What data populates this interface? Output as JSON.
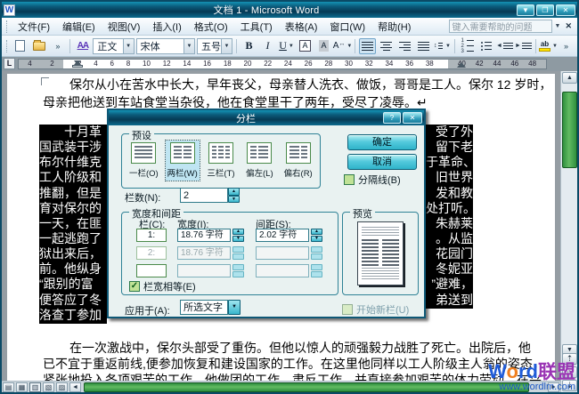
{
  "window": {
    "title": "文档 1 - Microsoft Word",
    "min_glyph": "▼",
    "restore_glyph": "❐",
    "close_glyph": "✕",
    "app_initial": "W"
  },
  "menu": {
    "items": [
      "文件(F)",
      "编辑(E)",
      "视图(V)",
      "插入(I)",
      "格式(O)",
      "工具(T)",
      "表格(A)",
      "窗口(W)",
      "帮助(H)"
    ],
    "help_placeholder": "键入需要帮助的问题",
    "dropdown_glyph": "▼",
    "close_glyph": "✕"
  },
  "toolbar": {
    "overflow_glyph": "»",
    "styles_icon": "AA",
    "style_value": "正文",
    "font_value": "宋体",
    "size_value": "五号",
    "bold": "B",
    "italic": "I",
    "underline": "U",
    "char_border": "A",
    "char_shading": "A",
    "char_scale": "A",
    "highlight_ab": "ab",
    "caret_glyph": "▼",
    "updown_glyph": "↕",
    "num1": "1",
    "num2": "2",
    "num3": "3",
    "left_tri": "◄",
    "right_tri": "►"
  },
  "ruler": {
    "left": [
      "4",
      "2"
    ],
    "mid": [
      "2",
      "4",
      "6",
      "8",
      "10",
      "12",
      "14",
      "16",
      "18",
      "20",
      "22",
      "24",
      "26",
      "28",
      "30",
      "32",
      "34",
      "36",
      "38"
    ],
    "right": [
      "40",
      "42",
      "44",
      "46",
      "48"
    ],
    "tab_selector": "L"
  },
  "doc": {
    "p1_l1": "保尔从小在苦水中长大，早年丧父，母亲替人洗衣、做饭，哥哥是工人。保尔 12 岁时，",
    "p1_l2": "母亲把他送到车站食堂当杂役，他在食堂里干了两年，受尽了凌辱。↵",
    "sel_left": [
      "十月革",
      "国武装干涉",
      "布尔什维克",
      "工人阶级和",
      "推翻，但是",
      "育对保尔的",
      "一天，在匪",
      "一起逃跑了",
      "狱出来后，",
      "前。他纵身",
      "“跟别的富",
      "便答应了冬",
      "洛查丁参加"
    ],
    "sel_right": [
      "受了外",
      "留下老",
      "于革命、",
      "旧世界",
      "发和教",
      "处打听。",
      "朱赫莱",
      "。从监",
      "花园门",
      "冬妮亚",
      "”避难，",
      "弟送到"
    ],
    "p2_l1": "在一次激战中，保尔头部受了重伤。但他以惊人的顽强毅力战胜了死亡。出院后，他",
    "p2_l2": "已不宜于重返前线,便参加恢复和建设国家的工作。在这里他同样以工人阶级主人翁的姿态，",
    "p2_l3": "紧张地投入各项艰苦的工作。他做团的工作、肃反工作，并直接参加艰苦的体力劳动。在兴"
  },
  "dialog": {
    "title": "分栏",
    "help_glyph": "?",
    "close_glyph": "✕",
    "preset_group": "预设",
    "presets": [
      {
        "label": "一栏(O)"
      },
      {
        "label": "两栏(W)"
      },
      {
        "label": "三栏(T)"
      },
      {
        "label": "偏左(L)"
      },
      {
        "label": "偏右(R)"
      }
    ],
    "selected_preset": "两栏(W)",
    "ok": "确定",
    "cancel": "取消",
    "separator": "分隔线(B)",
    "columns_label": "栏数(N):",
    "columns_value": "2",
    "width_group": "宽度和间距",
    "h_col": "栏(C):",
    "h_width": "宽度(I):",
    "h_spacing": "间距(S):",
    "rows": [
      {
        "col": "1:",
        "width": "18.76 字符",
        "spacing": "2.02 字符"
      },
      {
        "col": "2:",
        "width": "18.76 字符",
        "spacing": ""
      },
      {
        "col": "",
        "width": "",
        "spacing": ""
      }
    ],
    "equal": "栏宽相等(E)",
    "apply_label": "应用于(A):",
    "apply_value": "所选文字",
    "preview_group": "预览",
    "start_new": "开始新栏(U)",
    "check_glyph": "✓",
    "up_glyph": "▲",
    "down_glyph": "▼"
  },
  "scroll": {
    "up_glyph": "▲",
    "down_glyph": "▼",
    "left_glyph": "◄",
    "right_glyph": "►",
    "page_up_glyph": "⇡",
    "browse_glyph": "○",
    "page_down_glyph": "⇣",
    "view_normal": "▤",
    "view_web": "▦",
    "view_print": "▥",
    "view_outline": "▧",
    "view_reading": "▨"
  },
  "watermark": {
    "w": "W",
    "o": "o",
    "r": "r",
    "d": "d",
    "suffix": "联盟",
    "url": "www.wordlm.com"
  },
  "colors": {
    "titlebar_teal": "#0b5a7a",
    "button_teal": "#2fb3c9",
    "scroll_thumb_green": "#2e8f3e",
    "checkbox_green": "#c0e296",
    "highlight_yellow": "#ffe400",
    "watermark_blue": "#1f5bd8",
    "watermark_orange": "#f08020",
    "watermark_purple": "#9a34b4",
    "selection_black": "#000000"
  }
}
